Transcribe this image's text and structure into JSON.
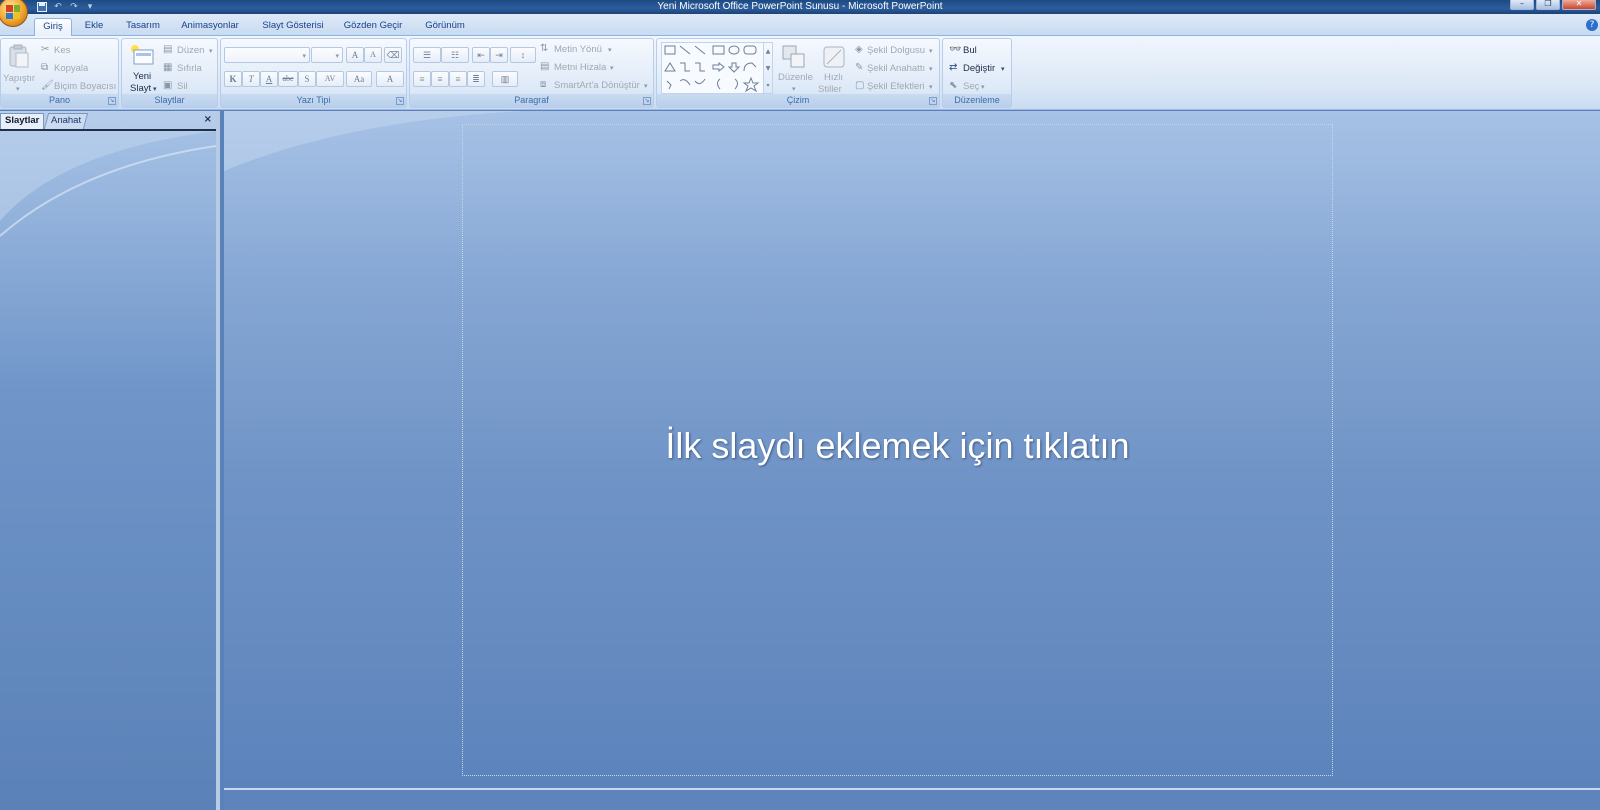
{
  "window": {
    "title": "Yeni Microsoft Office PowerPoint Sunusu - Microsoft PowerPoint",
    "controls": [
      "minimize-icon",
      "restore-icon",
      "close-icon"
    ]
  },
  "qat": {
    "icons": [
      "save-icon",
      "undo-icon",
      "redo-icon",
      "customize-icon"
    ]
  },
  "tabs": [
    "Giriş",
    "Ekle",
    "Tasarım",
    "Animasyonlar",
    "Slayt Gösterisi",
    "Gözden Geçir",
    "Görünüm"
  ],
  "active_tab": "Giriş",
  "ribbon": {
    "pano": {
      "label": "Pano",
      "paste": "Yapıştır",
      "cut": "Kes",
      "copy": "Kopyala",
      "format_painter": "Biçim Boyacısı"
    },
    "slaytlar": {
      "label": "Slaytlar",
      "new_slide_1": "Yeni",
      "new_slide_2": "Slayt",
      "layout": "Düzen",
      "reset": "Sıfırla",
      "delete": "Sil"
    },
    "yazi_tipi": {
      "label": "Yazı Tipi",
      "bold": "K",
      "italic": "T",
      "underline": "A",
      "strike": "abc",
      "shadow": "S",
      "spacing": "AV",
      "case": "Aa",
      "color": "A",
      "grow": "A",
      "shrink": "A"
    },
    "paragraf": {
      "label": "Paragraf",
      "text_direction": "Metin Yönü",
      "align_text": "Metni Hizala",
      "smartart": "SmartArt'a Dönüştür"
    },
    "cizim": {
      "label": "Çizim",
      "arrange": "Düzenle",
      "quick_styles_1": "Hızlı",
      "quick_styles_2": "Stiller",
      "shape_fill": "Şekil Dolgusu",
      "shape_outline": "Şekil Anahattı",
      "shape_effects": "Şekil Efektleri"
    },
    "duzenleme": {
      "label": "Düzenleme",
      "find": "Bul",
      "replace": "Değiştir",
      "select": "Seç"
    }
  },
  "left_panel": {
    "tab_slides": "Slaytlar",
    "tab_outline": "Anahat",
    "close": "×"
  },
  "slide": {
    "placeholder_text": "İlk slaydı eklemek için tıklatın"
  },
  "colors": {
    "accent": "#15428b",
    "slide_top": "#a7c2e6",
    "slide_bottom": "#5c83bc"
  }
}
